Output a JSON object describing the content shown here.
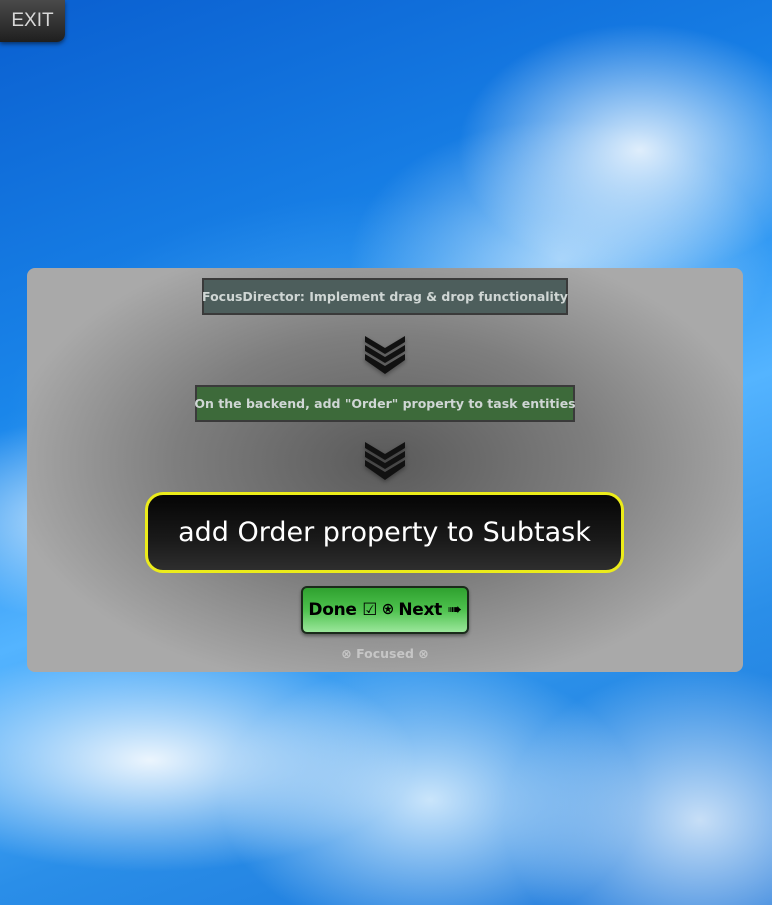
{
  "header": {
    "exit_label": "EXIT"
  },
  "focus": {
    "goal": "FocusDirector: Implement drag & drop functionality",
    "parent_task": "On the backend, add \"Order\" property to task entities",
    "current_task": "add Order property to Subtask",
    "done_next_label": "Done ☑ ⍟ Next ➠",
    "status": "⊗ Focused ⊗"
  },
  "colors": {
    "goal_chip": "#4d5e5c",
    "parent_chip": "#3d6a3a",
    "current_task_border": "#ecec1a",
    "done_button": "#4ec24e"
  },
  "icons": {
    "arrows": "triple-chevron-down-icon"
  }
}
